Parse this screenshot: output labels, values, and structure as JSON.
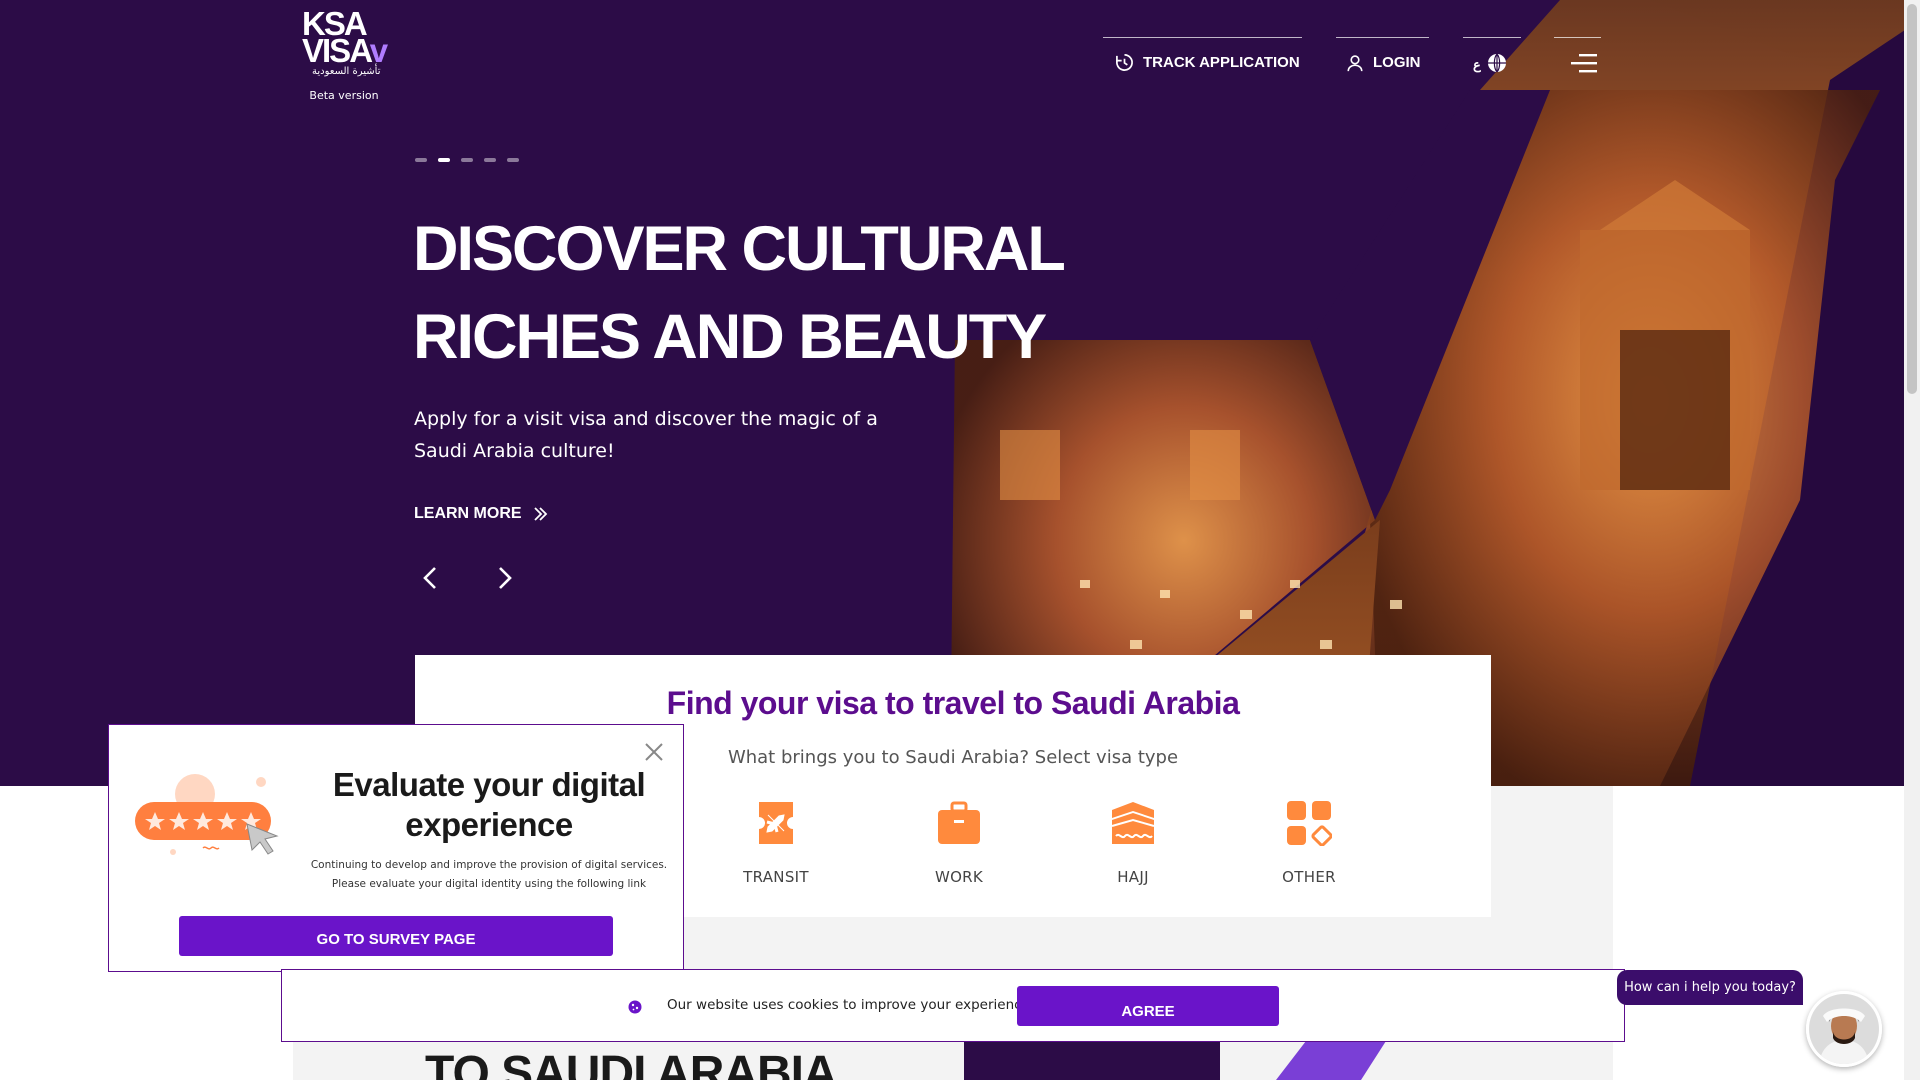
{
  "brand": {
    "logo_main": "KSA VISA",
    "logo_arabic": "تأشيرة السعودية",
    "beta_label": "Beta version"
  },
  "nav": {
    "track_label": "TRACK APPLICATION",
    "login_label": "LOGIN",
    "lang_code": "ع"
  },
  "hero": {
    "title_line1": "DISCOVER CULTURAL",
    "title_line2": "RICHES AND BEAUTY",
    "subtitle": "Apply for a visit visa and discover the magic of a Saudi Arabia culture!",
    "learn_more": "LEARN MORE",
    "slide_count": 5,
    "active_slide": 2
  },
  "visa_finder": {
    "title": "Find your visa to travel to Saudi Arabia",
    "question": "What brings you to Saudi Arabia? Select visa type",
    "types": [
      {
        "label": "TRANSIT",
        "icon": "airplane-ticket-icon"
      },
      {
        "label": "WORK",
        "icon": "briefcase-icon"
      },
      {
        "label": "HAJJ",
        "icon": "kaaba-icon"
      },
      {
        "label": "OTHER",
        "icon": "grid-shapes-icon"
      }
    ]
  },
  "bottom": {
    "heading": "TO SAUDI ARABIA"
  },
  "survey": {
    "title": "Evaluate your digital experience",
    "desc_line1": "Continuing to develop and improve the provision of digital services.",
    "desc_line2": "Please evaluate your digital identity using the following link",
    "button": "GO TO SURVEY PAGE"
  },
  "cookie": {
    "text": "Our website uses cookies to improve your experience.",
    "button": "AGREE"
  },
  "chat": {
    "prompt": "How can i help you today?"
  },
  "colors": {
    "hero_bg": "#2c0c47",
    "brand_purple": "#6a14c9",
    "title_purple": "#5c0d8e",
    "icon_orange": "#ff8a3d"
  }
}
